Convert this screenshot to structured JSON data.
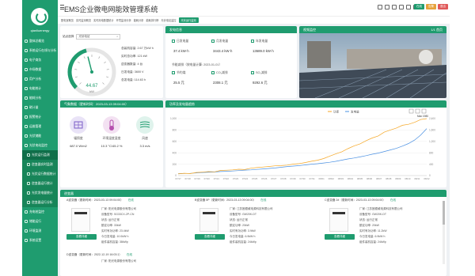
{
  "app": {
    "title": "EMS企业微电网能效管理系统",
    "username": "qianliuenergy"
  },
  "sidebar": {
    "items": [
      {
        "label": "整体总概览",
        "type": "main"
      },
      {
        "label": "系统运行在线与分析",
        "type": "main"
      },
      {
        "label": "电子商务",
        "type": "main"
      },
      {
        "label": "市场数据",
        "type": "main"
      },
      {
        "label": "用户分析",
        "type": "main"
      },
      {
        "label": "电能统计",
        "type": "main"
      },
      {
        "label": "能耗分析",
        "type": "main"
      },
      {
        "label": "碳计量",
        "type": "main"
      },
      {
        "label": "报警统计",
        "type": "main"
      },
      {
        "label": "运维管理",
        "type": "main"
      },
      {
        "label": "光伏储能",
        "type": "main"
      },
      {
        "label": "光伏电站监控",
        "type": "main"
      },
      {
        "label": "光伏运行监测",
        "type": "sub",
        "active": true
      },
      {
        "label": "逆变器实时监测",
        "type": "sub"
      },
      {
        "label": "光伏运行数据统计",
        "type": "sub"
      },
      {
        "label": "逆变器运行统计",
        "type": "sub"
      },
      {
        "label": "光伏发电量统计",
        "type": "sub"
      },
      {
        "label": "逆变器运行分析",
        "type": "sub"
      },
      {
        "label": "充电桩监控",
        "type": "main"
      },
      {
        "label": "储能运行",
        "type": "main"
      },
      {
        "label": "环境监测",
        "type": "main"
      },
      {
        "label": "系统设置",
        "type": "main"
      }
    ]
  },
  "header": {
    "buttons": [
      {
        "label": "在线",
        "color": "#1f9c6f"
      },
      {
        "label": "告警",
        "color": "#e6a23c"
      },
      {
        "label": "退出",
        "color": "#e05a5a"
      }
    ]
  },
  "tabs": [
    {
      "label": "配电室概览"
    },
    {
      "label": "实时监测概览"
    },
    {
      "label": "实时用电数据统计"
    },
    {
      "label": "环境监测分析"
    },
    {
      "label": "能耗分析"
    },
    {
      "label": "能耗排行榜"
    },
    {
      "label": "光伏电站监控"
    },
    {
      "label": "光伏运行监测",
      "active": true
    }
  ],
  "monitor": {
    "station_label": "站点选择",
    "station_value": "光伏电站",
    "gauge_value": "44.67",
    "gauge_unit": "kW",
    "gauge_level": 0.447,
    "stats": [
      "总装机容量: 2.67 万kW h",
      "实时总功率: 121 kW",
      "逆变器数量: 4 台",
      "日发电量: 3600 V",
      "总发电量: 114.63 h"
    ]
  },
  "generation": {
    "title": "发电信息",
    "items": [
      {
        "label": "日发电量",
        "value": "37.4 kW·h"
      },
      {
        "label": "月发电量",
        "value": "3443.4 kW·h"
      },
      {
        "label": "年发电量",
        "value": "13689.0 kW·h"
      }
    ],
    "saving_title": "节能减排（按电量计算: 2023-01-01）",
    "saving": [
      {
        "label": "节约煤",
        "value": "25.5 元"
      },
      {
        "label": "CO₂减排",
        "value": "2308.1 元"
      },
      {
        "label": "SO₂减排",
        "value": "9292.6 元"
      }
    ]
  },
  "video": {
    "title": "视频监控",
    "pager": "1/1 首页"
  },
  "weather": {
    "title": "气象数据（更新时间：2023-03-13 09:04:00）",
    "items": [
      {
        "label": "辐照度",
        "value": "687.0 W/m2",
        "color": "#e9e3f7",
        "icon": "solar-panel-icon"
      },
      {
        "label": "环境温度湿度",
        "value": "10.3 °C/45.2 %",
        "color": "#f3e1f2",
        "icon": "thermometer-icon"
      },
      {
        "label": "风速",
        "value": "3.3 m/s",
        "color": "#dff3ec",
        "icon": "wind-icon"
      }
    ]
  },
  "chart_data": {
    "type": "line",
    "title": "功率及发电量趋势",
    "series": [
      {
        "name": "功率",
        "color": "#f5a623"
      },
      {
        "name": "发电量",
        "color": "#4a90e2"
      }
    ],
    "x": [
      "07/17",
      "07/18",
      "07/19",
      "07/20",
      "07/21",
      "07/22",
      "07/23",
      "07/24",
      "07/25",
      "07/26",
      "07/27",
      "07/28",
      "07/29",
      "07/30",
      "07/31",
      "08/01",
      "08/02",
      "08/03",
      "08/04",
      "08/05",
      "08/06",
      "08/07",
      "08/08",
      "08/09",
      "08/10",
      "08/11",
      "08/12"
    ],
    "ylim_left": [
      0,
      1000
    ],
    "ylim_right": [
      0,
      2400
    ],
    "left_ticks": [
      "1,000",
      "800",
      "600",
      "400",
      "200",
      "0"
    ],
    "right_ticks": [
      "2,400",
      "1,600",
      "1,200",
      "800",
      "400",
      "0"
    ],
    "annotations": [
      "Max 1980"
    ],
    "power": [
      30,
      40,
      35,
      55,
      60,
      70,
      65,
      90,
      95,
      100,
      110,
      105,
      130,
      140,
      150,
      160,
      170,
      175,
      185,
      200,
      210,
      230,
      250,
      270,
      300,
      340,
      380,
      420,
      470,
      520,
      560,
      610,
      660,
      700,
      760,
      800,
      840,
      880,
      900,
      940,
      980,
      1000
    ],
    "energy": [
      80,
      90,
      95,
      110,
      130,
      140,
      150,
      170,
      180,
      195,
      210,
      230,
      240,
      260,
      280,
      300,
      320,
      350,
      380,
      400,
      420,
      450,
      480,
      500,
      530,
      560,
      600,
      650,
      700,
      740,
      790,
      840,
      900,
      950,
      1010,
      1080,
      1150,
      1240,
      1350,
      1500,
      1700,
      1980
    ]
  },
  "inverters": {
    "title": "逆变器",
    "cards": [
      {
        "header": "A逆变器（更新时间：2023-03-13 09:04:00）",
        "status": "在线",
        "lines": [
          "厂家: 阳光电源股份有限公司",
          "设备型号: SG33CX-2P-CN",
          "状态: 运行正常",
          "额定功率: 33kW",
          "实时有功功率: 23.4kW",
          "今日发电量: 10.0kW·h",
          "组件装机容量: 38kWp"
        ],
        "button": "查看详细"
      },
      {
        "header": "B逆变器 5P（更新时间：2023-03-13 09:04:00）",
        "status": "在线",
        "lines": [
          "厂家: 江苏固德威电源科技有限公司",
          "设备型号: GW20K-DT",
          "状态: 运行正常",
          "额定功率: 20kW",
          "实时有功功率: 3.9kW",
          "今日发电量: 6.9kW·h",
          "组件装机容量: 24kWp"
        ],
        "button": "查看详细"
      },
      {
        "header": "C逆变器 2#（更新时间：2023-03-13 09:04:00）",
        "status": "在线",
        "lines": [
          "厂家: 江苏固德威电源科技有限公司",
          "设备型号: GW20K-DT",
          "状态: 运行正常",
          "额定功率: 20kW",
          "实时有功功率: 11.2kW",
          "今日发电量: 6.9kW·h",
          "组件装机容量: 24kWp"
        ],
        "button": "查看详细"
      },
      {
        "header": "D逆变器（更新时间：2022-12-19 16:03:1）",
        "status": "在线",
        "lines": [
          "厂家: 阳光电源股份有限公司"
        ],
        "button": ""
      }
    ]
  }
}
